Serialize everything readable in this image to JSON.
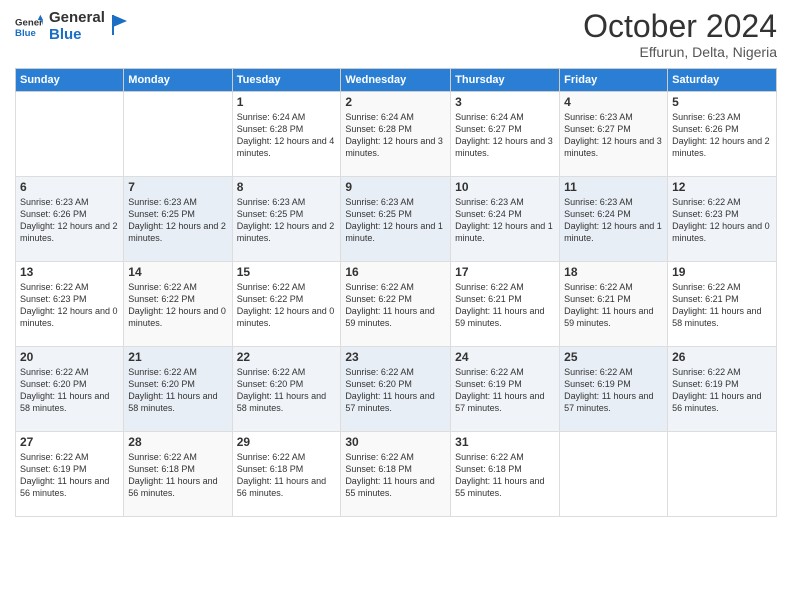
{
  "logo": {
    "text_general": "General",
    "text_blue": "Blue"
  },
  "header": {
    "month": "October 2024",
    "location": "Effurun, Delta, Nigeria"
  },
  "weekdays": [
    "Sunday",
    "Monday",
    "Tuesday",
    "Wednesday",
    "Thursday",
    "Friday",
    "Saturday"
  ],
  "weeks": [
    [
      {
        "day": "",
        "sunrise": "",
        "sunset": "",
        "daylight": ""
      },
      {
        "day": "",
        "sunrise": "",
        "sunset": "",
        "daylight": ""
      },
      {
        "day": "1",
        "sunrise": "Sunrise: 6:24 AM",
        "sunset": "Sunset: 6:28 PM",
        "daylight": "Daylight: 12 hours and 4 minutes."
      },
      {
        "day": "2",
        "sunrise": "Sunrise: 6:24 AM",
        "sunset": "Sunset: 6:28 PM",
        "daylight": "Daylight: 12 hours and 3 minutes."
      },
      {
        "day": "3",
        "sunrise": "Sunrise: 6:24 AM",
        "sunset": "Sunset: 6:27 PM",
        "daylight": "Daylight: 12 hours and 3 minutes."
      },
      {
        "day": "4",
        "sunrise": "Sunrise: 6:23 AM",
        "sunset": "Sunset: 6:27 PM",
        "daylight": "Daylight: 12 hours and 3 minutes."
      },
      {
        "day": "5",
        "sunrise": "Sunrise: 6:23 AM",
        "sunset": "Sunset: 6:26 PM",
        "daylight": "Daylight: 12 hours and 2 minutes."
      }
    ],
    [
      {
        "day": "6",
        "sunrise": "Sunrise: 6:23 AM",
        "sunset": "Sunset: 6:26 PM",
        "daylight": "Daylight: 12 hours and 2 minutes."
      },
      {
        "day": "7",
        "sunrise": "Sunrise: 6:23 AM",
        "sunset": "Sunset: 6:25 PM",
        "daylight": "Daylight: 12 hours and 2 minutes."
      },
      {
        "day": "8",
        "sunrise": "Sunrise: 6:23 AM",
        "sunset": "Sunset: 6:25 PM",
        "daylight": "Daylight: 12 hours and 2 minutes."
      },
      {
        "day": "9",
        "sunrise": "Sunrise: 6:23 AM",
        "sunset": "Sunset: 6:25 PM",
        "daylight": "Daylight: 12 hours and 1 minute."
      },
      {
        "day": "10",
        "sunrise": "Sunrise: 6:23 AM",
        "sunset": "Sunset: 6:24 PM",
        "daylight": "Daylight: 12 hours and 1 minute."
      },
      {
        "day": "11",
        "sunrise": "Sunrise: 6:23 AM",
        "sunset": "Sunset: 6:24 PM",
        "daylight": "Daylight: 12 hours and 1 minute."
      },
      {
        "day": "12",
        "sunrise": "Sunrise: 6:22 AM",
        "sunset": "Sunset: 6:23 PM",
        "daylight": "Daylight: 12 hours and 0 minutes."
      }
    ],
    [
      {
        "day": "13",
        "sunrise": "Sunrise: 6:22 AM",
        "sunset": "Sunset: 6:23 PM",
        "daylight": "Daylight: 12 hours and 0 minutes."
      },
      {
        "day": "14",
        "sunrise": "Sunrise: 6:22 AM",
        "sunset": "Sunset: 6:22 PM",
        "daylight": "Daylight: 12 hours and 0 minutes."
      },
      {
        "day": "15",
        "sunrise": "Sunrise: 6:22 AM",
        "sunset": "Sunset: 6:22 PM",
        "daylight": "Daylight: 12 hours and 0 minutes."
      },
      {
        "day": "16",
        "sunrise": "Sunrise: 6:22 AM",
        "sunset": "Sunset: 6:22 PM",
        "daylight": "Daylight: 11 hours and 59 minutes."
      },
      {
        "day": "17",
        "sunrise": "Sunrise: 6:22 AM",
        "sunset": "Sunset: 6:21 PM",
        "daylight": "Daylight: 11 hours and 59 minutes."
      },
      {
        "day": "18",
        "sunrise": "Sunrise: 6:22 AM",
        "sunset": "Sunset: 6:21 PM",
        "daylight": "Daylight: 11 hours and 59 minutes."
      },
      {
        "day": "19",
        "sunrise": "Sunrise: 6:22 AM",
        "sunset": "Sunset: 6:21 PM",
        "daylight": "Daylight: 11 hours and 58 minutes."
      }
    ],
    [
      {
        "day": "20",
        "sunrise": "Sunrise: 6:22 AM",
        "sunset": "Sunset: 6:20 PM",
        "daylight": "Daylight: 11 hours and 58 minutes."
      },
      {
        "day": "21",
        "sunrise": "Sunrise: 6:22 AM",
        "sunset": "Sunset: 6:20 PM",
        "daylight": "Daylight: 11 hours and 58 minutes."
      },
      {
        "day": "22",
        "sunrise": "Sunrise: 6:22 AM",
        "sunset": "Sunset: 6:20 PM",
        "daylight": "Daylight: 11 hours and 58 minutes."
      },
      {
        "day": "23",
        "sunrise": "Sunrise: 6:22 AM",
        "sunset": "Sunset: 6:20 PM",
        "daylight": "Daylight: 11 hours and 57 minutes."
      },
      {
        "day": "24",
        "sunrise": "Sunrise: 6:22 AM",
        "sunset": "Sunset: 6:19 PM",
        "daylight": "Daylight: 11 hours and 57 minutes."
      },
      {
        "day": "25",
        "sunrise": "Sunrise: 6:22 AM",
        "sunset": "Sunset: 6:19 PM",
        "daylight": "Daylight: 11 hours and 57 minutes."
      },
      {
        "day": "26",
        "sunrise": "Sunrise: 6:22 AM",
        "sunset": "Sunset: 6:19 PM",
        "daylight": "Daylight: 11 hours and 56 minutes."
      }
    ],
    [
      {
        "day": "27",
        "sunrise": "Sunrise: 6:22 AM",
        "sunset": "Sunset: 6:19 PM",
        "daylight": "Daylight: 11 hours and 56 minutes."
      },
      {
        "day": "28",
        "sunrise": "Sunrise: 6:22 AM",
        "sunset": "Sunset: 6:18 PM",
        "daylight": "Daylight: 11 hours and 56 minutes."
      },
      {
        "day": "29",
        "sunrise": "Sunrise: 6:22 AM",
        "sunset": "Sunset: 6:18 PM",
        "daylight": "Daylight: 11 hours and 56 minutes."
      },
      {
        "day": "30",
        "sunrise": "Sunrise: 6:22 AM",
        "sunset": "Sunset: 6:18 PM",
        "daylight": "Daylight: 11 hours and 55 minutes."
      },
      {
        "day": "31",
        "sunrise": "Sunrise: 6:22 AM",
        "sunset": "Sunset: 6:18 PM",
        "daylight": "Daylight: 11 hours and 55 minutes."
      },
      {
        "day": "",
        "sunrise": "",
        "sunset": "",
        "daylight": ""
      },
      {
        "day": "",
        "sunrise": "",
        "sunset": "",
        "daylight": ""
      }
    ]
  ]
}
